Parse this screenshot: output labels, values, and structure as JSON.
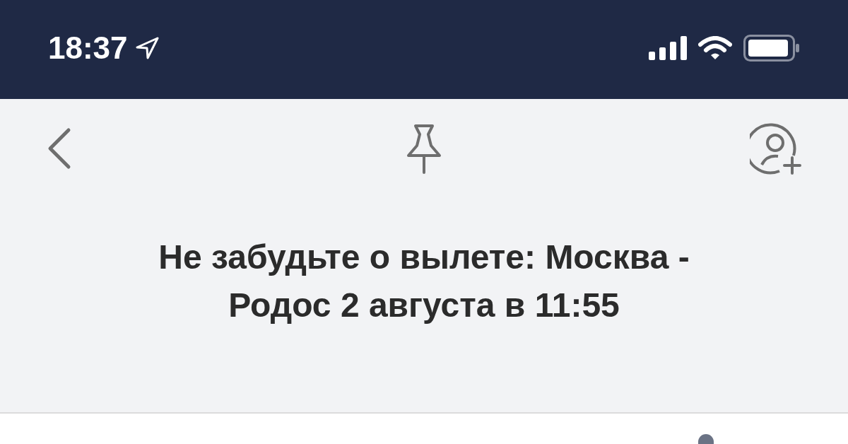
{
  "status_bar": {
    "time": "18:37"
  },
  "notification": {
    "title": "Не забудьте о вылете: Москва - Родос 2 августа в 11:55"
  }
}
